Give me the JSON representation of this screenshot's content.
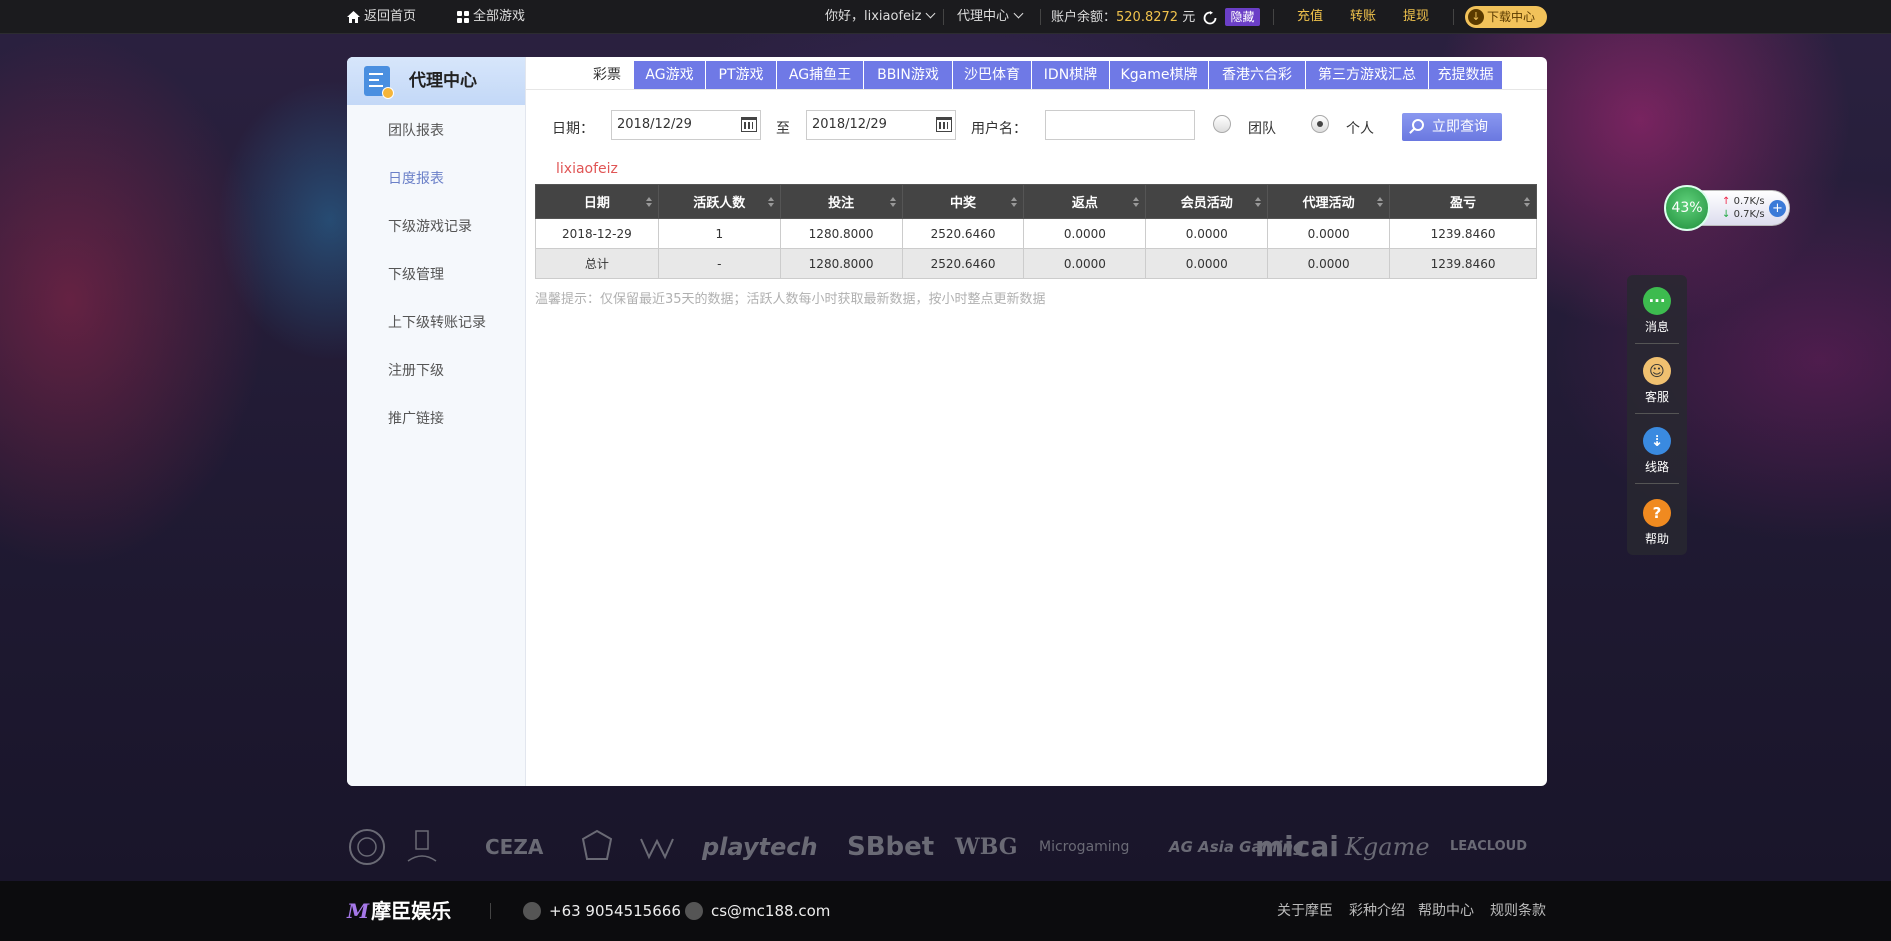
{
  "topbar": {
    "home": "返回首页",
    "all_games": "全部游戏",
    "greeting": "你好，lixiaofeiz",
    "agent_center": "代理中心",
    "balance_label": "账户余额：",
    "balance_value": "520.8272",
    "balance_unit": "元",
    "hide": "隐藏",
    "deposit": "充值",
    "transfer": "转账",
    "withdraw": "提现",
    "download": "下载中心"
  },
  "sidebar": {
    "title": "代理中心",
    "items": [
      "团队报表",
      "日度报表",
      "下级游戏记录",
      "下级管理",
      "上下级转账记录",
      "注册下级",
      "推广链接"
    ],
    "active_index": 1
  },
  "tabs": [
    "彩票",
    "AG游戏",
    "PT游戏",
    "AG捕鱼王",
    "BBIN游戏",
    "沙巴体育",
    "IDN棋牌",
    "Kgame棋牌",
    "香港六合彩",
    "第三方游戏汇总",
    "充提数据"
  ],
  "filters": {
    "date_label": "日期：",
    "start_date": "2018/12/29",
    "to_label": "至",
    "end_date": "2018/12/29",
    "username_label": "用户名：",
    "username_value": "",
    "team_label": "团队",
    "personal_label": "个人",
    "query_button": "立即查询"
  },
  "current_user": "lixiaofeiz",
  "table": {
    "headers": [
      "日期",
      "活跃人数",
      "投注",
      "中奖",
      "返点",
      "会员活动",
      "代理活动",
      "盈亏"
    ],
    "rows": [
      [
        "2018-12-29",
        "1",
        "1280.8000",
        "2520.6460",
        "0.0000",
        "0.0000",
        "0.0000",
        "1239.8460"
      ],
      [
        "总计",
        "-",
        "1280.8000",
        "2520.6460",
        "0.0000",
        "0.0000",
        "0.0000",
        "1239.8460"
      ]
    ]
  },
  "tip": "温馨提示：仅保留最近35天的数据；活跃人数每小时获取最新数据，按小时整点更新数据",
  "speed": {
    "percent": "43%",
    "up": "0.7K/s",
    "down": "0.7K/s"
  },
  "side_tools": [
    "消息",
    "客服",
    "线路",
    "帮助"
  ],
  "partner_logos": [
    "CEZA",
    "playtech",
    "SBbet",
    "WBG",
    "Microgaming",
    "AG Asia Gaming",
    "micai",
    "Kgame",
    "LEACLOUD"
  ],
  "footer": {
    "brand": "摩臣娱乐",
    "brand_mark": "M",
    "phone": "+63 9054515666",
    "email": "cs@mc188.com",
    "links": [
      "关于摩臣",
      "彩种介绍",
      "帮助中心",
      "规则条款"
    ]
  },
  "colors": {
    "tab_accent": "#6f79e6",
    "balance": "#f0c24c",
    "username": "#e05555"
  }
}
